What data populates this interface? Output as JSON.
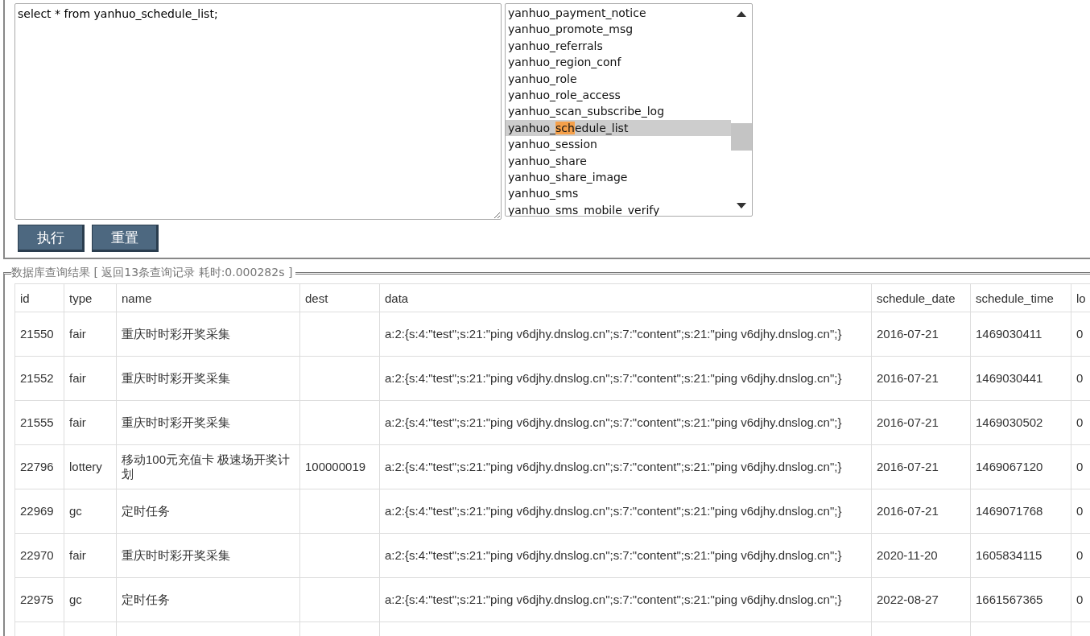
{
  "query_editor": {
    "value": "select * from yanhuo_schedule_list;"
  },
  "table_list": {
    "items": [
      {
        "label": "yanhuo_payment_notice",
        "selected": false
      },
      {
        "label": "yanhuo_promote_msg",
        "selected": false
      },
      {
        "label": "yanhuo_referrals",
        "selected": false
      },
      {
        "label": "yanhuo_region_conf",
        "selected": false
      },
      {
        "label": "yanhuo_role",
        "selected": false
      },
      {
        "label": "yanhuo_role_access",
        "selected": false
      },
      {
        "label": "yanhuo_scan_subscribe_log",
        "selected": false
      },
      {
        "selected": true,
        "segments": [
          {
            "text": "yanhuo_",
            "highlighted": false
          },
          {
            "text": "sch",
            "highlighted": true
          },
          {
            "text": "edule_list",
            "highlighted": false
          }
        ]
      },
      {
        "label": "yanhuo_session",
        "selected": false
      },
      {
        "label": "yanhuo_share",
        "selected": false
      },
      {
        "label": "yanhuo_share_image",
        "selected": false
      },
      {
        "label": "yanhuo_sms",
        "selected": false
      },
      {
        "label": "yanhuo_sms_mobile_verify",
        "selected": false
      }
    ]
  },
  "buttons": [
    {
      "label": "执行"
    },
    {
      "label": "重置"
    }
  ],
  "results": {
    "legend": "数据库查询结果 [ 返回13条查询记录 耗时:0.000282s ]",
    "columns": [
      "id",
      "type",
      "name",
      "dest",
      "data",
      "schedule_date",
      "schedule_time",
      "lo"
    ],
    "rows": [
      [
        "21550",
        "fair",
        "重庆时时彩开奖采集",
        "",
        "a:2:{s:4:\"test\";s:21:\"ping v6djhy.dnslog.cn\";s:7:\"content\";s:21:\"ping v6djhy.dnslog.cn\";}",
        "2016-07-21",
        "1469030411",
        "0"
      ],
      [
        "21552",
        "fair",
        "重庆时时彩开奖采集",
        "",
        "a:2:{s:4:\"test\";s:21:\"ping v6djhy.dnslog.cn\";s:7:\"content\";s:21:\"ping v6djhy.dnslog.cn\";}",
        "2016-07-21",
        "1469030441",
        "0"
      ],
      [
        "21555",
        "fair",
        "重庆时时彩开奖采集",
        "",
        "a:2:{s:4:\"test\";s:21:\"ping v6djhy.dnslog.cn\";s:7:\"content\";s:21:\"ping v6djhy.dnslog.cn\";}",
        "2016-07-21",
        "1469030502",
        "0"
      ],
      [
        "22796",
        "lottery",
        "移动100元充值卡 极速场开奖计划",
        "100000019",
        "a:2:{s:4:\"test\";s:21:\"ping v6djhy.dnslog.cn\";s:7:\"content\";s:21:\"ping v6djhy.dnslog.cn\";}",
        "2016-07-21",
        "1469067120",
        "0"
      ],
      [
        "22969",
        "gc",
        "定时任务",
        "",
        "a:2:{s:4:\"test\";s:21:\"ping v6djhy.dnslog.cn\";s:7:\"content\";s:21:\"ping v6djhy.dnslog.cn\";}",
        "2016-07-21",
        "1469071768",
        "0"
      ],
      [
        "22970",
        "fair",
        "重庆时时彩开奖采集",
        "",
        "a:2:{s:4:\"test\";s:21:\"ping v6djhy.dnslog.cn\";s:7:\"content\";s:21:\"ping v6djhy.dnslog.cn\";}",
        "2020-11-20",
        "1605834115",
        "0"
      ],
      [
        "22975",
        "gc",
        "定时任务",
        "",
        "a:2:{s:4:\"test\";s:21:\"ping v6djhy.dnslog.cn\";s:7:\"content\";s:21:\"ping v6djhy.dnslog.cn\";}",
        "2022-08-27",
        "1661567365",
        "0"
      ]
    ]
  }
}
